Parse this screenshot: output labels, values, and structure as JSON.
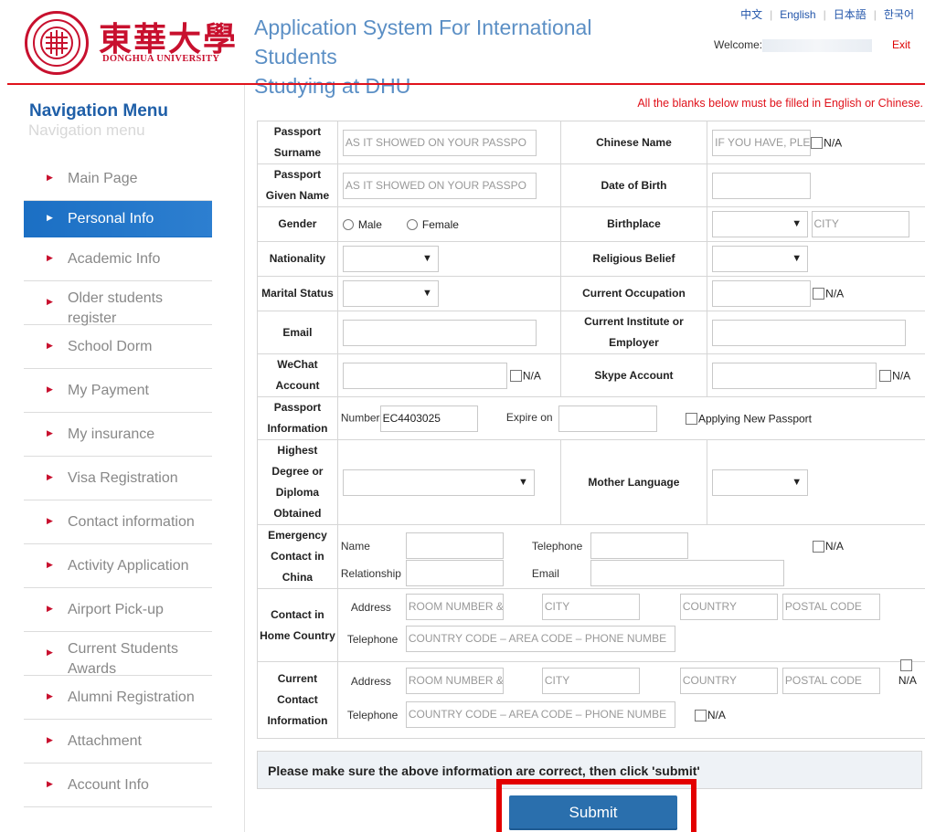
{
  "header": {
    "logo_cn": "東華大學",
    "logo_en": "DONGHUA UNIVERSITY",
    "title_line1": "Application System For International Students",
    "title_line2": "Studying at DHU",
    "languages": [
      "中文",
      "English",
      "日本語",
      "한국어"
    ],
    "welcome": "Welcome:",
    "exit": "Exit",
    "accent_color": "#e0121b"
  },
  "sidebar": {
    "title": "Navigation Menu",
    "subtitle": "Navigation menu",
    "items": [
      {
        "label": "Main Page"
      },
      {
        "label": "Personal Info"
      },
      {
        "label": "Academic Info"
      },
      {
        "label": "Older students register"
      },
      {
        "label": "School Dorm"
      },
      {
        "label": "My Payment"
      },
      {
        "label": "My insurance"
      },
      {
        "label": "Visa Registration"
      },
      {
        "label": "Contact information"
      },
      {
        "label": "Activity Application"
      },
      {
        "label": "Airport Pick-up"
      },
      {
        "label": "Current Students Awards"
      },
      {
        "label": "Alumni Registration"
      },
      {
        "label": "Attachment"
      },
      {
        "label": "Account Info"
      }
    ],
    "active_color": "#1b6fc4"
  },
  "form": {
    "notice": "All the blanks below must be filled in English or Chinese.",
    "passport_surname": {
      "label": "Passport Surname",
      "placeholder": "AS IT SHOWED ON YOUR PASSPO"
    },
    "chinese_name": {
      "label": "Chinese Name",
      "placeholder": "IF YOU HAVE, PLE",
      "na": "N/A"
    },
    "passport_given": {
      "label": "Passport Given Name",
      "placeholder": "AS IT SHOWED ON YOUR PASSPO"
    },
    "dob": {
      "label": "Date of Birth"
    },
    "gender": {
      "label": "Gender",
      "male": "Male",
      "female": "Female"
    },
    "birthplace": {
      "label": "Birthplace",
      "city_placeholder": "CITY"
    },
    "nationality": {
      "label": "Nationality"
    },
    "religious": {
      "label": "Religious Belief"
    },
    "marital": {
      "label": "Marital Status"
    },
    "occupation": {
      "label": "Current Occupation",
      "na": "N/A"
    },
    "email": {
      "label": "Email"
    },
    "institute": {
      "label": "Current Institute or Employer"
    },
    "wechat": {
      "label": "WeChat Account",
      "na": "N/A"
    },
    "skype": {
      "label": "Skype Account",
      "na": "N/A"
    },
    "passport_info": {
      "label": "Passport Information",
      "number_label": "Number",
      "number_value": "EC4403025",
      "expire_label": "Expire on",
      "new_passport": "Applying New Passport"
    },
    "degree": {
      "label": "Highest Degree or Diploma Obtained"
    },
    "mother_language": {
      "label": "Mother Language"
    },
    "emergency": {
      "label": "Emergency Contact in China",
      "name": "Name",
      "telephone": "Telephone",
      "relationship": "Relationship",
      "email": "Email",
      "na": "N/A"
    },
    "home_contact": {
      "label": "Contact in Home Country",
      "address": "Address",
      "telephone": "Telephone",
      "ph_room": "ROOM NUMBER &",
      "ph_city": "CITY",
      "ph_country": "COUNTRY",
      "ph_postal": "POSTAL CODE",
      "ph_phone": "COUNTRY CODE – AREA CODE – PHONE NUMBE"
    },
    "current_contact": {
      "label": "Current Contact Information",
      "address": "Address",
      "telephone": "Telephone",
      "ph_room": "ROOM NUMBER &",
      "ph_city": "CITY",
      "ph_country": "COUNTRY",
      "ph_postal": "POSTAL CODE",
      "ph_phone": "COUNTRY CODE – AREA CODE – PHONE NUMBE",
      "na": "N/A",
      "na2": "N/A"
    },
    "confirm": "Please make sure the above information are correct, then click 'submit'",
    "submit": "Submit"
  }
}
